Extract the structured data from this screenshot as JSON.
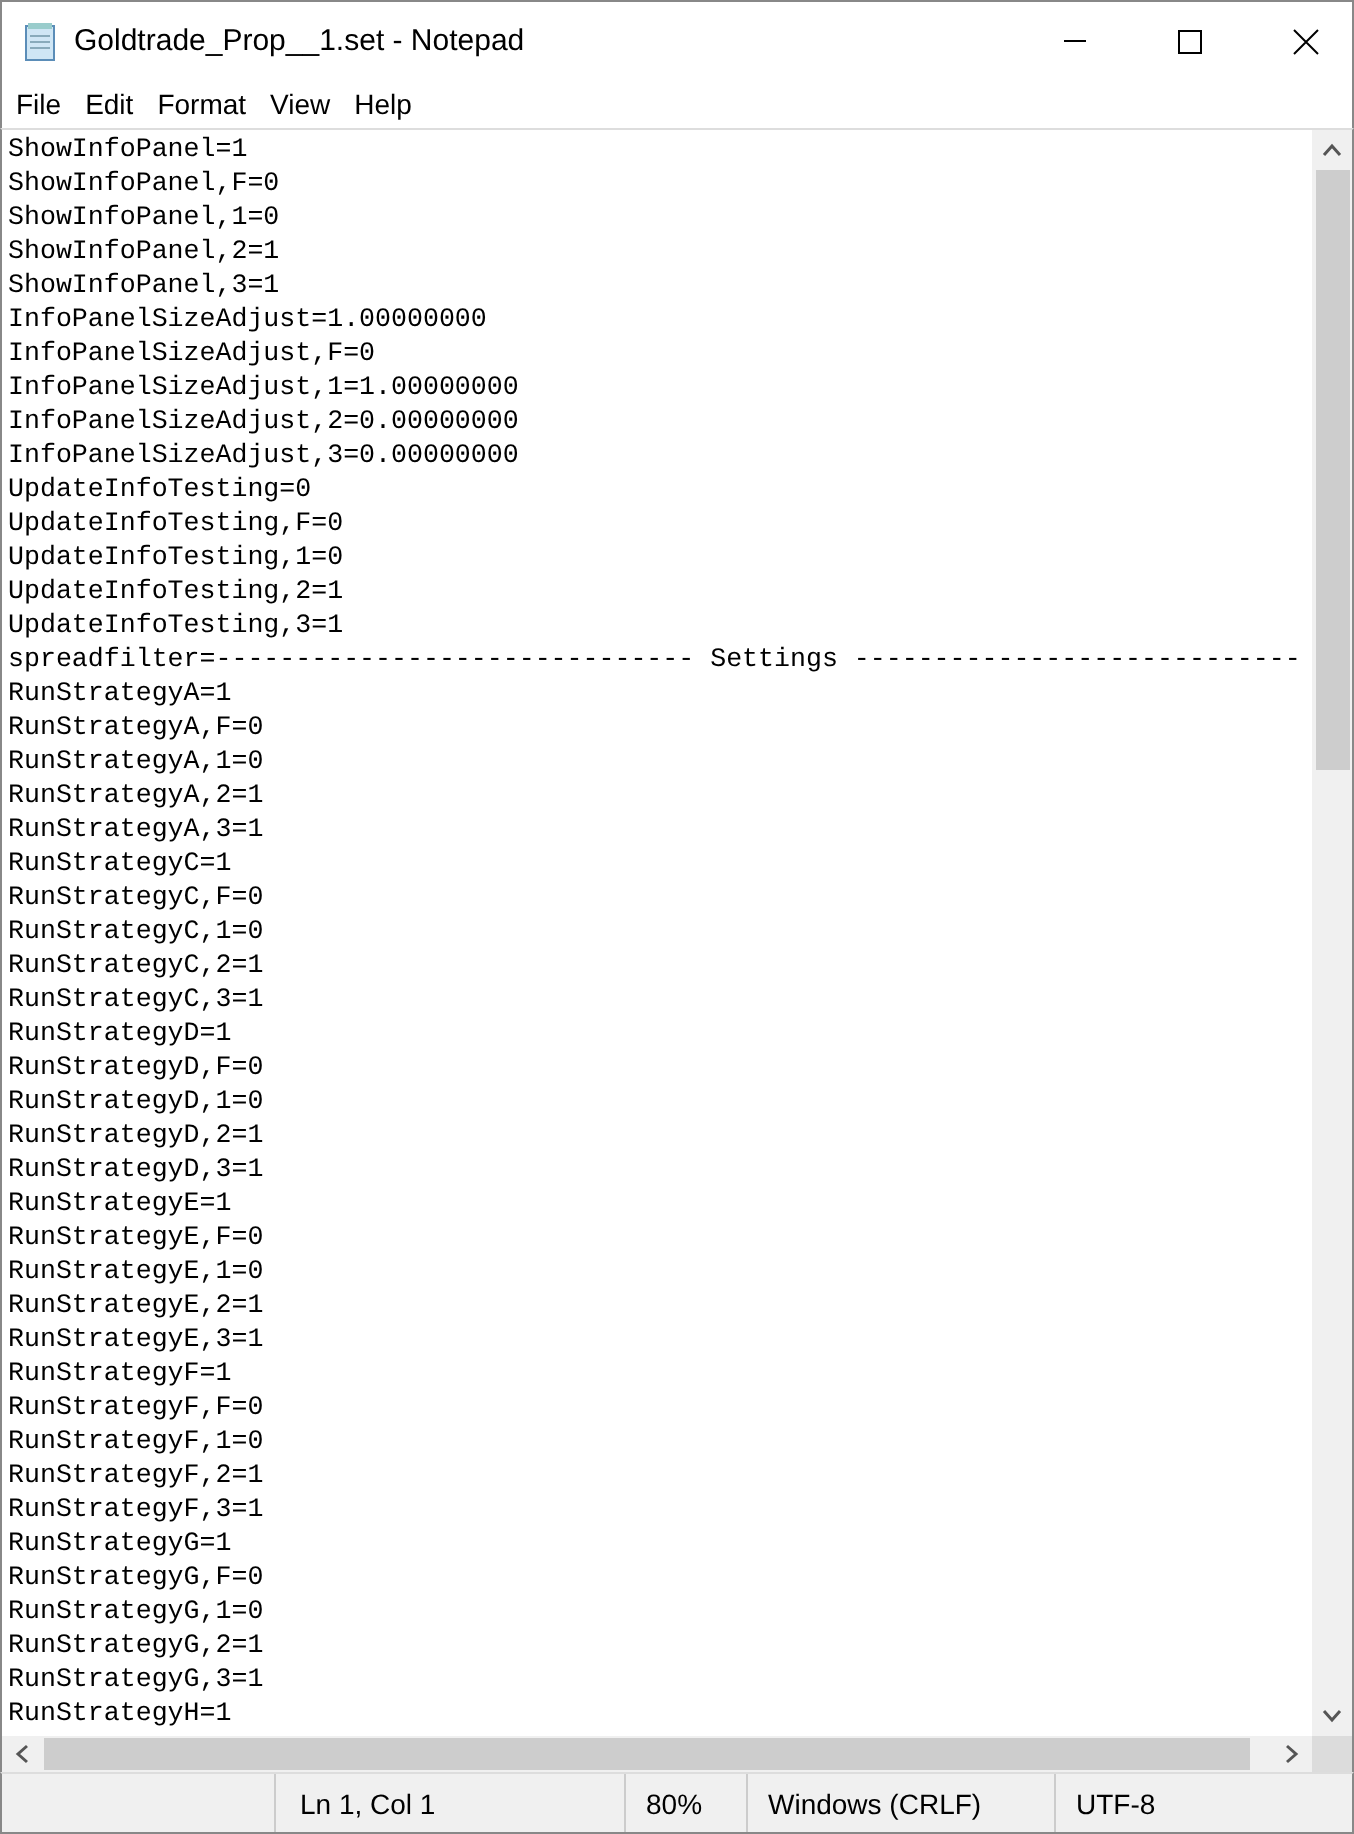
{
  "window": {
    "title": "Goldtrade_Prop__1.set - Notepad"
  },
  "menu": [
    "File",
    "Edit",
    "Format",
    "View",
    "Help"
  ],
  "editor": {
    "lines": [
      "ShowInfoPanel=1",
      "ShowInfoPanel,F=0",
      "ShowInfoPanel,1=0",
      "ShowInfoPanel,2=1",
      "ShowInfoPanel,3=1",
      "InfoPanelSizeAdjust=1.00000000",
      "InfoPanelSizeAdjust,F=0",
      "InfoPanelSizeAdjust,1=1.00000000",
      "InfoPanelSizeAdjust,2=0.00000000",
      "InfoPanelSizeAdjust,3=0.00000000",
      "UpdateInfoTesting=0",
      "UpdateInfoTesting,F=0",
      "UpdateInfoTesting,1=0",
      "UpdateInfoTesting,2=1",
      "UpdateInfoTesting,3=1",
      "spreadfilter=------------------------------ Settings ----------------------------",
      "RunStrategyA=1",
      "RunStrategyA,F=0",
      "RunStrategyA,1=0",
      "RunStrategyA,2=1",
      "RunStrategyA,3=1",
      "RunStrategyC=1",
      "RunStrategyC,F=0",
      "RunStrategyC,1=0",
      "RunStrategyC,2=1",
      "RunStrategyC,3=1",
      "RunStrategyD=1",
      "RunStrategyD,F=0",
      "RunStrategyD,1=0",
      "RunStrategyD,2=1",
      "RunStrategyD,3=1",
      "RunStrategyE=1",
      "RunStrategyE,F=0",
      "RunStrategyE,1=0",
      "RunStrategyE,2=1",
      "RunStrategyE,3=1",
      "RunStrategyF=1",
      "RunStrategyF,F=0",
      "RunStrategyF,1=0",
      "RunStrategyF,2=1",
      "RunStrategyF,3=1",
      "RunStrategyG=1",
      "RunStrategyG,F=0",
      "RunStrategyG,1=0",
      "RunStrategyG,2=1",
      "RunStrategyG,3=1",
      "RunStrategyH=1"
    ]
  },
  "status_bar": {
    "position": "Ln 1, Col 1",
    "zoom": "80%",
    "line_ending": "Windows (CRLF)",
    "encoding": "UTF-8"
  }
}
